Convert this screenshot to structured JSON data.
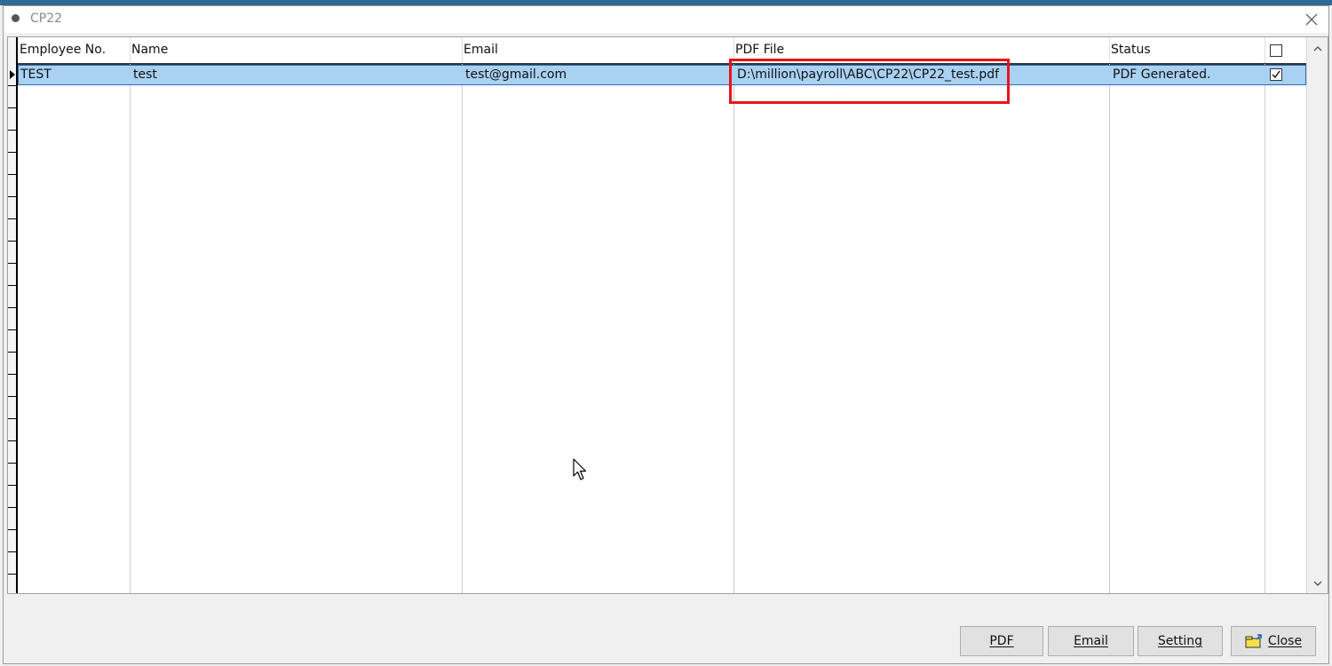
{
  "window": {
    "title": "CP22"
  },
  "grid": {
    "columns": [
      {
        "key": "employee_no",
        "label": "Employee No."
      },
      {
        "key": "name",
        "label": "Name"
      },
      {
        "key": "email",
        "label": "Email"
      },
      {
        "key": "pdf_file",
        "label": "PDF File"
      },
      {
        "key": "status",
        "label": "Status"
      }
    ],
    "select_all_checked": false,
    "rows": [
      {
        "employee_no": "TEST",
        "name": "test",
        "email": "test@gmail.com",
        "pdf_file": "D:\\million\\payroll\\ABC\\CP22\\CP22_test.pdf",
        "status": "PDF Generated.",
        "checked": true
      }
    ]
  },
  "buttons": {
    "pdf": "PDF",
    "email": "Email",
    "setting": "Setting",
    "close": "Close"
  },
  "colors": {
    "selected_row": "#a9d1f2",
    "highlight": "#e8141c",
    "title_accent": "#2f6a98"
  }
}
